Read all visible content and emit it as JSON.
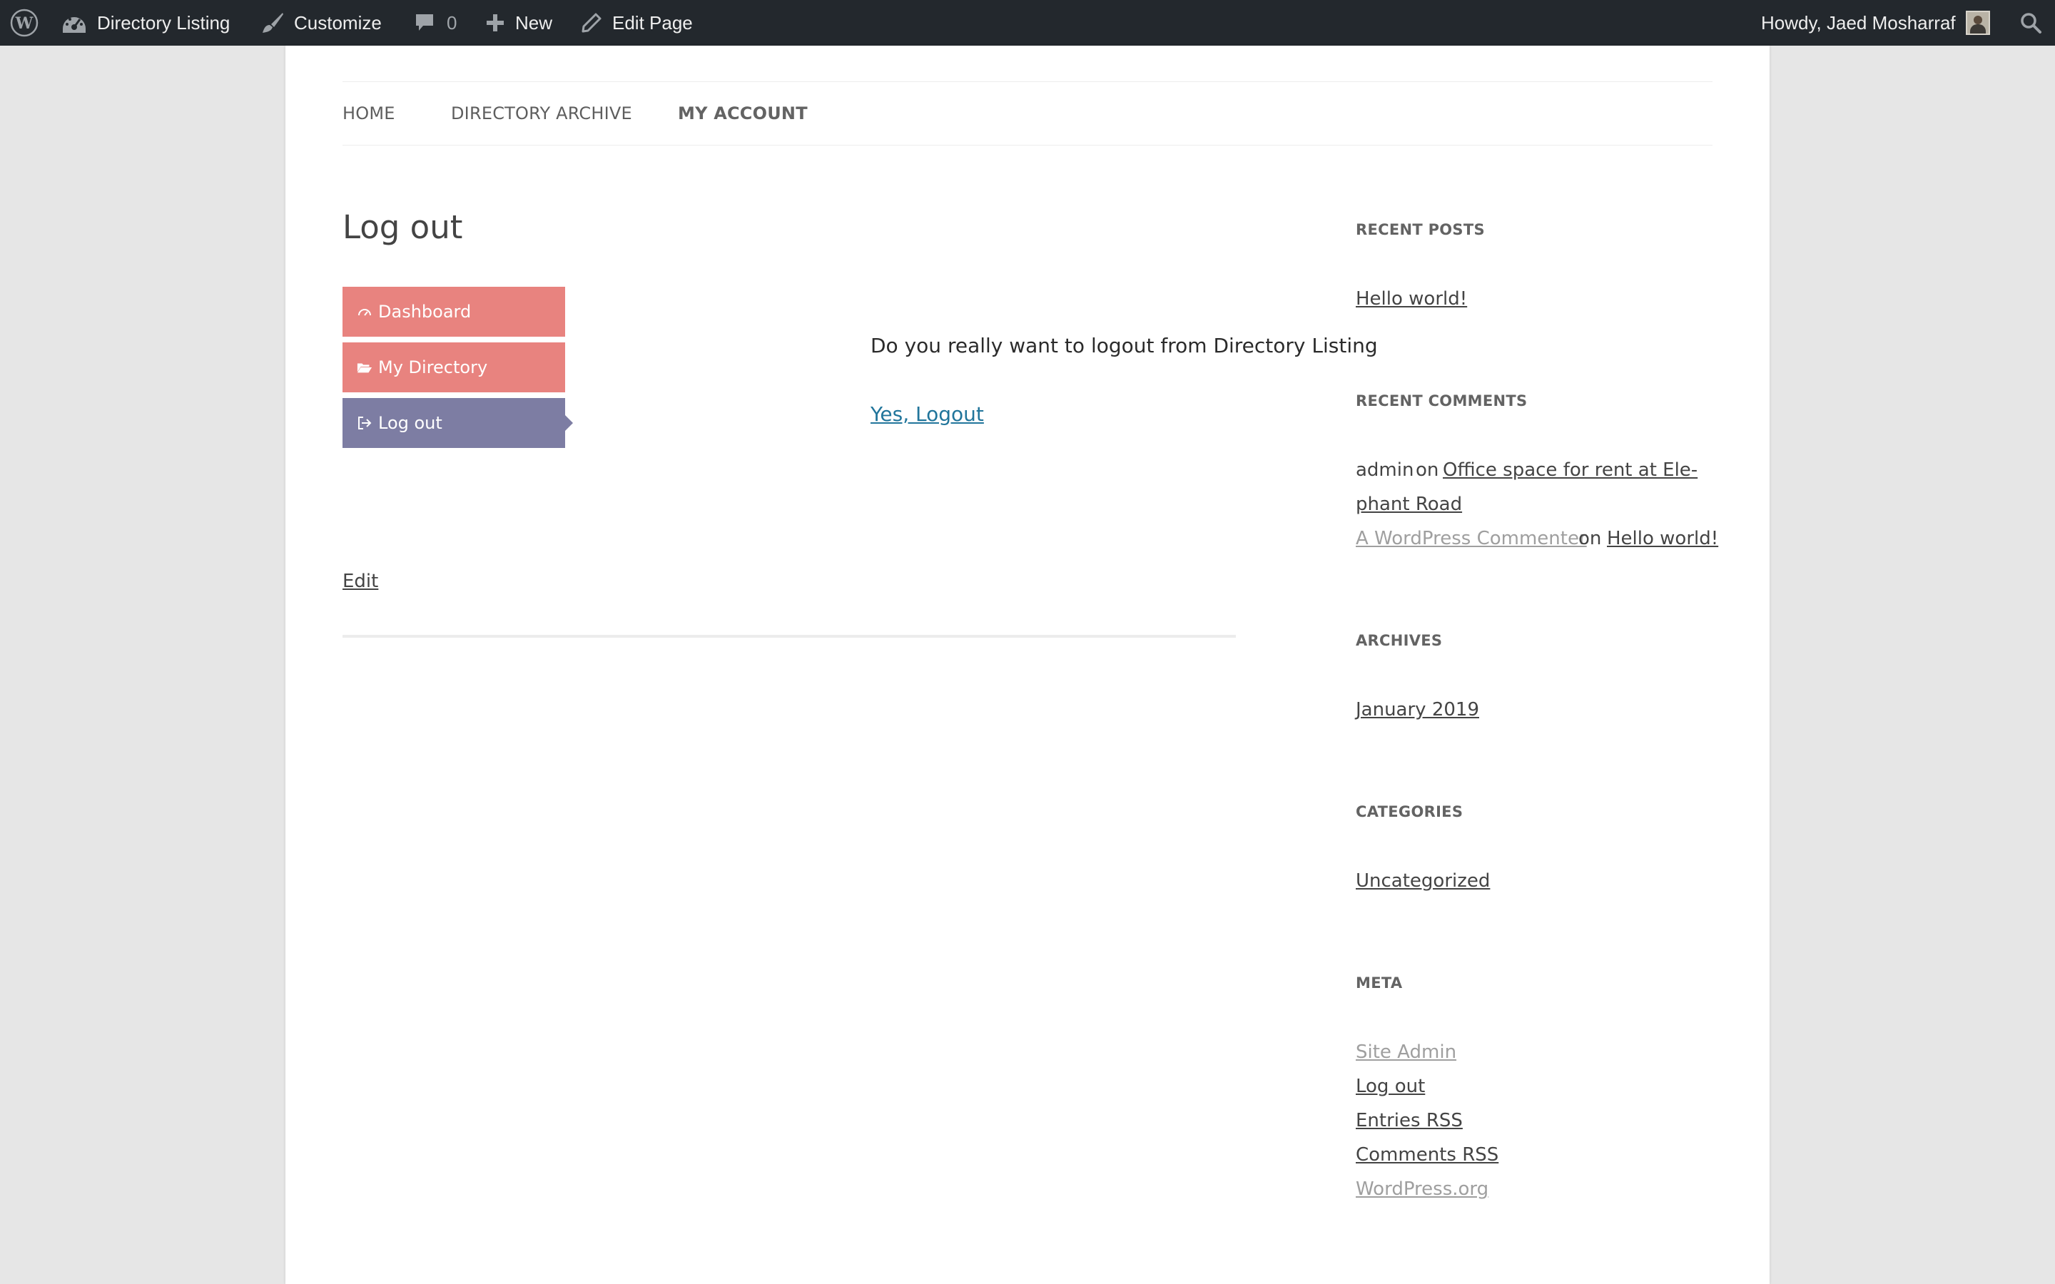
{
  "admin_bar": {
    "site_name": "Directory Listing",
    "customize": "Customize",
    "comments_count": "0",
    "new": "New",
    "edit_page": "Edit Page",
    "howdy": "Howdy, Jaed Mosharraf"
  },
  "nav": {
    "items": [
      {
        "label": "HOME"
      },
      {
        "label": "DIRECTORY ARCHIVE"
      },
      {
        "label": "MY ACCOUNT"
      }
    ]
  },
  "main": {
    "title": "Log out",
    "menu": [
      {
        "label": "Dashboard",
        "icon": "dashboard-icon"
      },
      {
        "label": "My Directory",
        "icon": "folder-open-icon"
      },
      {
        "label": "Log out",
        "icon": "sign-out-icon"
      }
    ],
    "question": "Do you really want to logout from Directory Listing",
    "yes_logout": "Yes, Logout",
    "edit": "Edit"
  },
  "sidebar": {
    "recent_posts": {
      "title": "RECENT POSTS",
      "items": [
        "Hello world!"
      ]
    },
    "recent_comments": {
      "title": "RECENT COMMENTS",
      "c1_author": "admin",
      "c1_on": "on",
      "c1_post_line1": "Office space for rent at Ele-",
      "c1_post_line2": "phant Road",
      "c2_author": "A WordPress Commenter",
      "c2_on": "on",
      "c2_post": "Hello world!"
    },
    "archives": {
      "title": "ARCHIVES",
      "items": [
        "January 2019"
      ]
    },
    "categories": {
      "title": "CATEGORIES",
      "items": [
        "Uncategorized"
      ]
    },
    "meta": {
      "title": "META",
      "items": [
        "Site Admin",
        "Log out",
        "Entries RSS",
        "Comments RSS",
        "WordPress.org"
      ]
    }
  },
  "colors": {
    "admin_bar_bg": "#23282d",
    "menu_pink": "#e8837f",
    "menu_active": "#7d7da3",
    "link_blue": "#21759b",
    "page_bg": "#e6e6e6"
  }
}
